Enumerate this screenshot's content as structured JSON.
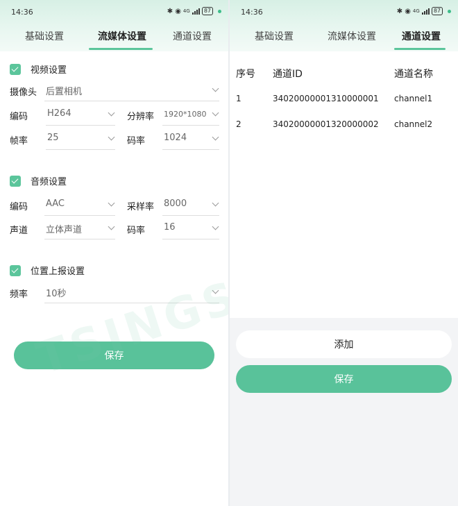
{
  "status": {
    "time": "14:36",
    "battery": "87",
    "network": "4G"
  },
  "tabs": [
    "基础设置",
    "流媒体设置",
    "通道设置"
  ],
  "left": {
    "video": {
      "title": "视频设置",
      "camera_label": "摄像头",
      "camera_value": "后置相机",
      "codec_label": "编码",
      "codec_value": "H264",
      "resolution_label": "分辨率",
      "resolution_value": "1920*1080",
      "fps_label": "帧率",
      "fps_value": "25",
      "bitrate_label": "码率",
      "bitrate_value": "1024"
    },
    "audio": {
      "title": "音频设置",
      "codec_label": "编码",
      "codec_value": "AAC",
      "samplerate_label": "采样率",
      "samplerate_value": "8000",
      "channel_label": "声道",
      "channel_value": "立体声道",
      "bitrate_label": "码率",
      "bitrate_value": "16"
    },
    "location": {
      "title": "位置上报设置",
      "freq_label": "频率",
      "freq_value": "10秒"
    },
    "save_label": "保存"
  },
  "right": {
    "headers": [
      "序号",
      "通道ID",
      "通道名称"
    ],
    "rows": [
      {
        "index": "1",
        "id": "34020000001310000001",
        "name": "channel1"
      },
      {
        "index": "2",
        "id": "34020000001320000002",
        "name": "channel2"
      }
    ],
    "add_label": "添加",
    "save_label": "保存"
  },
  "accent_color": "#59c29a",
  "watermark": "TSINGSEE青犀视频"
}
